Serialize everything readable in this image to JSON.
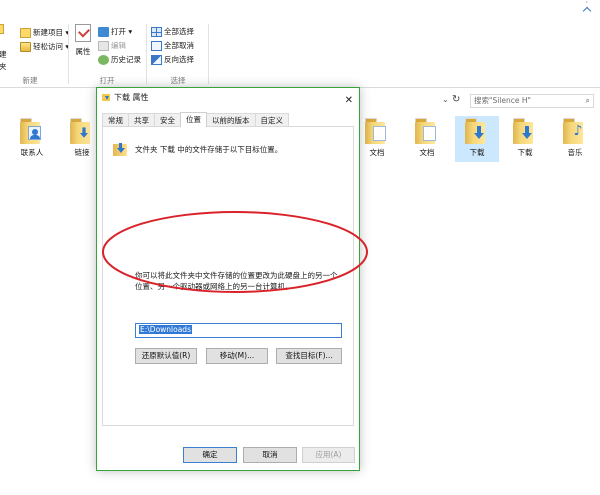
{
  "ribbon": {
    "left_group": {
      "items": [
        "建",
        "夹"
      ],
      "title": "新建"
    },
    "new_group": {
      "new_item": "新建项目 ▾",
      "easy_access": "轻松访问 ▾"
    },
    "open_group": {
      "title": "打开",
      "props_label": "属性",
      "open": "打开 ▾",
      "edit": "编辑",
      "history": "历史记录"
    },
    "select_group": {
      "title": "选择",
      "select_all": "全部选择",
      "select_none": "全部取消",
      "invert": "反向选择"
    }
  },
  "address_bar": {
    "search_placeholder": "搜索\"Silence H\"",
    "refresh": "↻",
    "dropdown": "⌄",
    "search_icon": "⌕"
  },
  "folders": [
    {
      "label": "联系人",
      "icon": "contacts-icon"
    },
    {
      "label": "链接",
      "icon": "links-folder-icon"
    },
    {
      "label": "文档",
      "icon": "documents-folder-icon"
    },
    {
      "label": "文档",
      "icon": "documents-folder-icon"
    },
    {
      "label": "下载",
      "icon": "downloads-folder-icon",
      "selected": true
    },
    {
      "label": "下载",
      "icon": "downloads-folder-icon"
    },
    {
      "label": "音乐",
      "icon": "music-folder-icon"
    }
  ],
  "dialog": {
    "title": "下载 属性",
    "close": "✕",
    "tabs": [
      "常规",
      "共享",
      "安全",
      "位置",
      "以前的版本",
      "自定义"
    ],
    "active_tab": "位置",
    "location": {
      "heading": "文件夹 下载 中的文件存储于以下目标位置。",
      "description_lines": [
        "你可以将此文件夹中文件存储的位置更改为此硬盘上的另一个",
        "位置、另一个驱动器或网络上的另一台计算机。"
      ],
      "path_value": "E:\\Downloads",
      "restore_default": "还原默认值(R)",
      "move": "移动(M)...",
      "find_target": "查找目标(F)..."
    },
    "buttons": {
      "ok": "确定",
      "cancel": "取消",
      "apply": "应用(A)"
    }
  },
  "colors": {
    "dialog_border": "#39a33b",
    "annotation": "#d9222a",
    "selection": "#3078d7",
    "folder_selected": "#cce8ff"
  }
}
